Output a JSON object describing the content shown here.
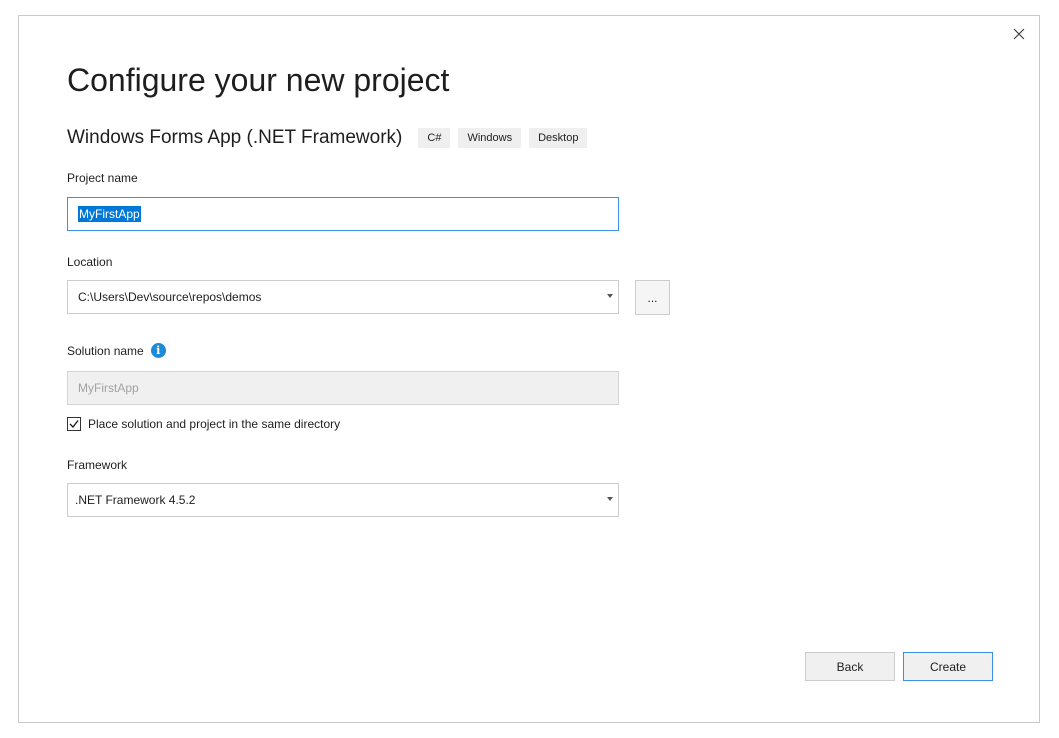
{
  "dialog": {
    "heading": "Configure your new project",
    "close_icon": "close-icon"
  },
  "template": {
    "name": "Windows Forms App (.NET Framework)",
    "tags": [
      "C#",
      "Windows",
      "Desktop"
    ]
  },
  "project_name": {
    "label": "Project name",
    "value": "MyFirstApp"
  },
  "location": {
    "label": "Location",
    "value": "C:\\Users\\Dev\\source\\repos\\demos",
    "browse_label": "..."
  },
  "solution_name": {
    "label": "Solution name",
    "info_icon": "info-icon",
    "value": "MyFirstApp"
  },
  "same_directory": {
    "label": "Place solution and project in the same directory",
    "checked": true
  },
  "framework": {
    "label": "Framework",
    "value": ".NET Framework 4.5.2"
  },
  "buttons": {
    "back": "Back",
    "create": "Create"
  },
  "colors": {
    "accent": "#0078d7",
    "focus_border": "#3c8ee6",
    "info": "#1e8bd8"
  }
}
